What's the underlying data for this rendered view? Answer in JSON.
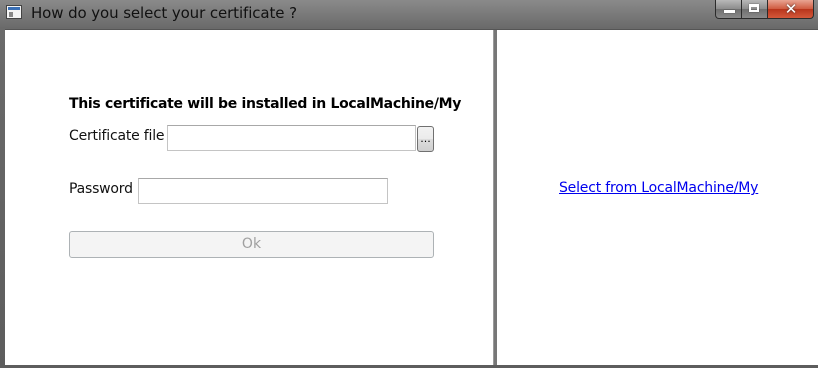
{
  "window": {
    "title": "How do you select your certificate ?",
    "icon": "app-window-icon"
  },
  "caption_buttons": {
    "minimize_icon": "minimize-icon",
    "maximize_icon": "maximize-icon",
    "close_glyph": "✕"
  },
  "form": {
    "heading": "This certificate will be installed in LocalMachine/My",
    "certificate_label": "Certificate file :",
    "certificate_value": "",
    "browse_label": "...",
    "password_label": "Password :",
    "password_value": "",
    "ok_label": "Ok",
    "ok_enabled": false
  },
  "right_pane": {
    "select_link": "Select from LocalMachine/My"
  },
  "colors": {
    "link": "#0000ee",
    "disabled_text": "#a0a0a0",
    "close_button": "#c8432a"
  }
}
